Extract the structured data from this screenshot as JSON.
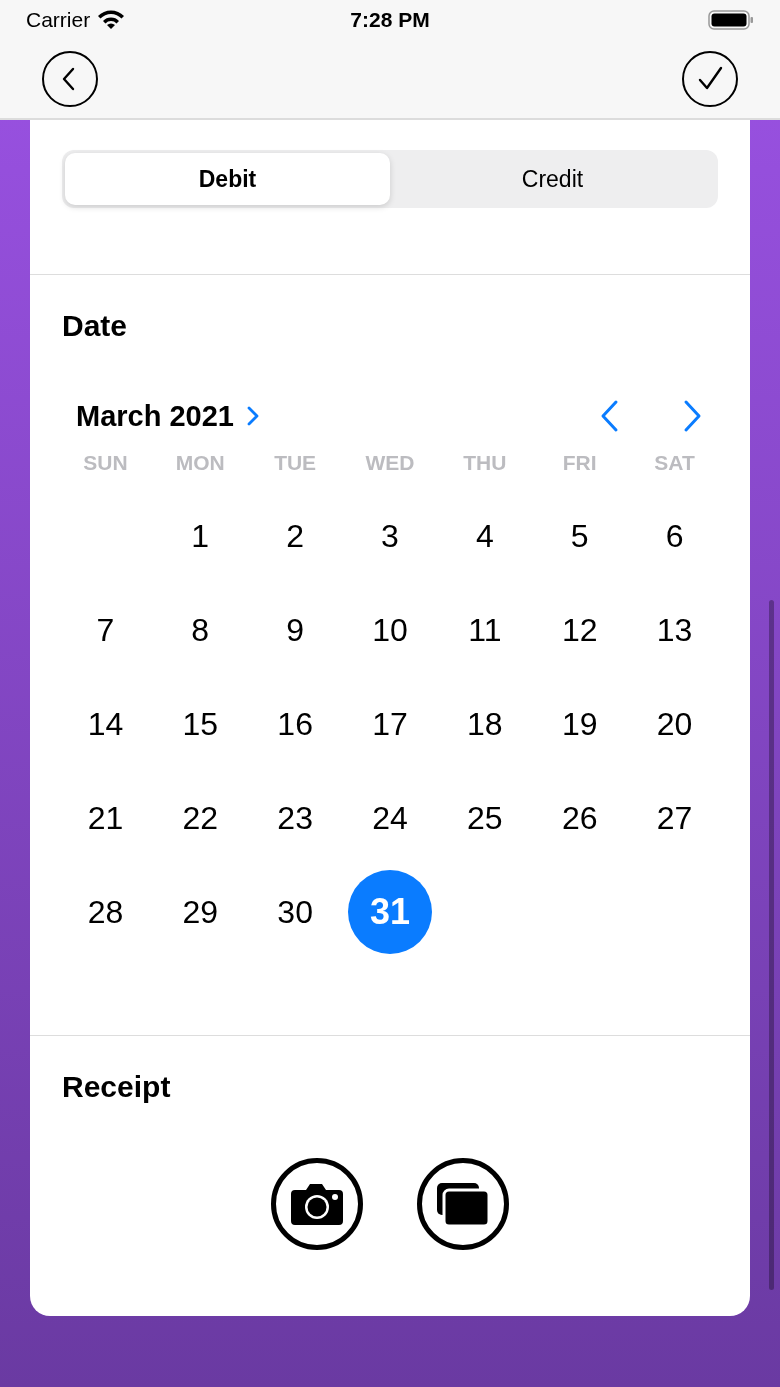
{
  "status_bar": {
    "carrier": "Carrier",
    "time": "7:28 PM"
  },
  "segments": [
    {
      "label": "Debit",
      "selected": true
    },
    {
      "label": "Credit",
      "selected": false
    }
  ],
  "date_section": {
    "title": "Date",
    "month": "March 2021",
    "weekdays": [
      "SUN",
      "MON",
      "TUE",
      "WED",
      "THU",
      "FRI",
      "SAT"
    ],
    "weeks": [
      {
        "days": [
          {
            "label": "1",
            "selected": false
          },
          {
            "label": "2",
            "selected": false
          },
          {
            "label": "3",
            "selected": false
          },
          {
            "label": "4",
            "selected": false
          },
          {
            "label": "5",
            "selected": false
          },
          {
            "label": "6",
            "selected": false
          }
        ]
      },
      {
        "days": [
          {
            "label": "7",
            "selected": false
          },
          {
            "label": "8",
            "selected": false
          },
          {
            "label": "9",
            "selected": false
          },
          {
            "label": "10",
            "selected": false
          },
          {
            "label": "11",
            "selected": false
          },
          {
            "label": "12",
            "selected": false
          },
          {
            "label": "13",
            "selected": false
          }
        ]
      },
      {
        "days": [
          {
            "label": "14",
            "selected": false
          },
          {
            "label": "15",
            "selected": false
          },
          {
            "label": "16",
            "selected": false
          },
          {
            "label": "17",
            "selected": false
          },
          {
            "label": "18",
            "selected": false
          },
          {
            "label": "19",
            "selected": false
          },
          {
            "label": "20",
            "selected": false
          }
        ]
      },
      {
        "days": [
          {
            "label": "21",
            "selected": false
          },
          {
            "label": "22",
            "selected": false
          },
          {
            "label": "23",
            "selected": false
          },
          {
            "label": "24",
            "selected": false
          },
          {
            "label": "25",
            "selected": false
          },
          {
            "label": "26",
            "selected": false
          },
          {
            "label": "27",
            "selected": false
          }
        ]
      },
      {
        "days": [
          {
            "label": "28",
            "selected": false
          },
          {
            "label": "29",
            "selected": false
          },
          {
            "label": "30",
            "selected": false
          },
          {
            "label": "31",
            "selected": true
          }
        ]
      }
    ]
  },
  "receipt_section": {
    "title": "Receipt"
  }
}
